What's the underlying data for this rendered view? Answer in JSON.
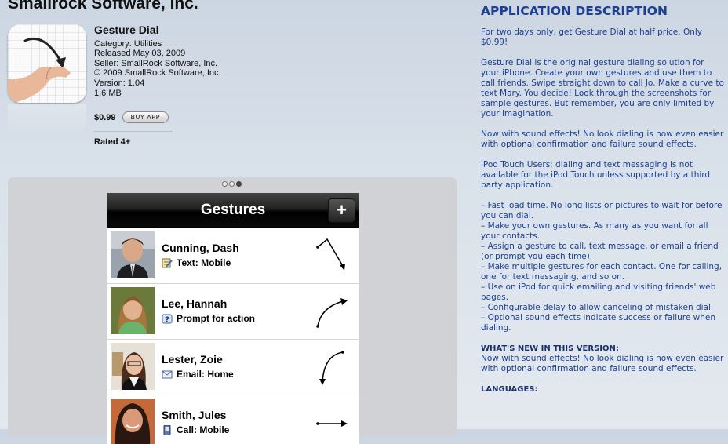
{
  "header": {
    "title": "Smallrock Software, Inc."
  },
  "app": {
    "name": "Gesture Dial",
    "category": "Category: Utilities",
    "released": "Released May 03, 2009",
    "seller": "Seller: SmallRock Software, Inc.",
    "copyright": "© 2009 SmallRock Software, Inc.",
    "version": "Version: 1.04",
    "size": "1.6 MB",
    "price": "$0.99",
    "buy_label": "BUY APP",
    "rating": "Rated 4+"
  },
  "screenshot": {
    "title": "Gestures",
    "add_label": "+",
    "contacts": [
      {
        "name": "Cunning, Dash",
        "action": "Text: Mobile",
        "action_icon": "notepad-icon"
      },
      {
        "name": "Lee, Hannah",
        "action": "Prompt for action",
        "action_icon": "question-icon"
      },
      {
        "name": "Lester, Zoie",
        "action": "Email: Home",
        "action_icon": "envelope-icon"
      },
      {
        "name": "Smith, Jules",
        "action": "Call: Mobile",
        "action_icon": "phone-icon"
      }
    ]
  },
  "description": {
    "heading": "APPLICATION DESCRIPTION",
    "paragraphs": [
      "For two days only, get Gesture Dial at half price. Only $0.99!",
      "Gesture Dial is the original gesture dialing solution for your iPhone. Create your own gestures and use them to call friends. Swipe straight down to call Jo. Make a curve to text Mary. You decide! Look through the screenshots for sample gestures. But remember, you are only limited by your imagination.",
      "Now with sound effects! No look dialing is now even easier with optional confirmation and failure sound effects.",
      "iPod Touch Users: dialing and text messaging is not available for the iPod Touch unless supported by a third party application.",
      "– Fast load time. No long lists or pictures to wait for before you can dial.\n– Make your own gestures. As many as you want for all your contacts.\n– Assign a gesture to call, text message, or email a friend (or prompt you each time).\n– Make multiple gestures for each contact. One for calling, one for text messaging, and so on.\n– Use on iPod for quick emailing and visiting friends' web pages.\n– Configurable delay to allow canceling of mistaken dial.\n– Optional sound effects indicate success or failure when dialing."
    ],
    "whats_new_heading": "WHAT'S NEW IN THIS VERSION:",
    "whats_new_text": "Now with sound effects! No look dialing is now even easier with optional confirmation and failure sound effects.",
    "languages_heading": "LANGUAGES:"
  }
}
